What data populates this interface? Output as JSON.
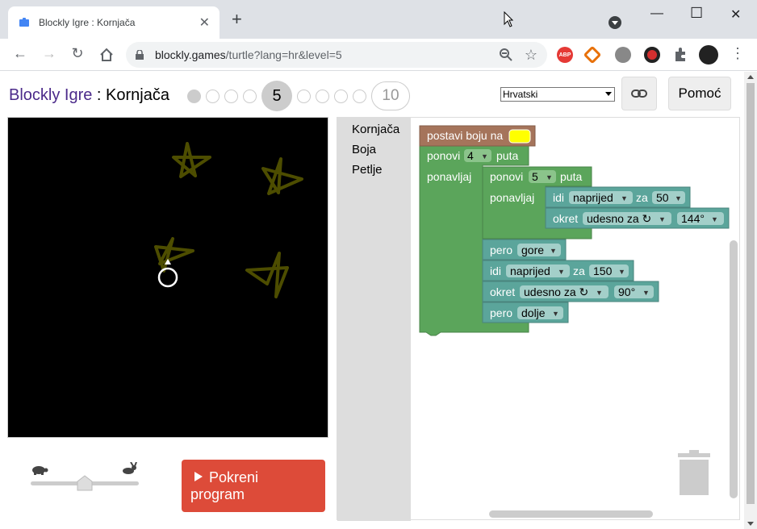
{
  "browser": {
    "tab_title": "Blockly Igre : Kornjača",
    "url_host": "blockly.games",
    "url_path": "/turtle?lang=hr&level=5",
    "ext_abp": "ABP"
  },
  "header": {
    "brand": "Blockly Igre",
    "separator": " : ",
    "game": "Kornjača",
    "current_level": "5",
    "last_level": "10",
    "language": "Hrvatski",
    "help_label": "Pomoć"
  },
  "controls": {
    "run_label": "Pokreni program"
  },
  "toolbox": {
    "categories": [
      "Kornjača",
      "Boja",
      "Petlje"
    ]
  },
  "blocks": {
    "set_colour": "postavi boju na",
    "colour_value": "#ffff00",
    "repeat_outer": "ponovi",
    "repeat_outer_count": "4",
    "times": "puta",
    "do": "ponavljaj",
    "repeat_inner": "ponovi",
    "repeat_inner_count": "5",
    "move": "idi",
    "forward": "naprijed",
    "by": "za",
    "move_inner_value": "50",
    "turn": "okret",
    "right": "udesno za ↻",
    "turn_inner_value": "144°",
    "pen": "pero",
    "pen_up": "gore",
    "move_outer_value": "150",
    "turn_outer_value": "90°",
    "pen_down": "dolje"
  },
  "colors": {
    "colour_block": "#a5745b",
    "loop_block": "#5ba55b",
    "turtle_block": "#5ba59b",
    "run_button": "#dd4b39",
    "star": "#4d4d00"
  }
}
